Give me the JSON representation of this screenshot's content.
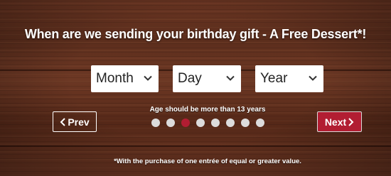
{
  "headline": "When are we sending your birthday gift - A Free Dessert*!",
  "date_selects": {
    "month": {
      "selected": "Month"
    },
    "day": {
      "selected": "Day"
    },
    "year": {
      "selected": "Year"
    }
  },
  "age_note": "Age should be more than 13 years",
  "nav": {
    "prev_label": "Prev",
    "next_label": "Next"
  },
  "progress": {
    "total_steps": 8,
    "current_step": 3
  },
  "footnote": "*With the purchase of one entrée of equal or greater value.",
  "colors": {
    "accent_red": "#b21d32",
    "wood_brown": "#5a2c1a",
    "dot_inactive": "#dcdcdc"
  },
  "icons": {
    "select_chevron": "chevron-down-icon",
    "prev": "chevron-left-icon",
    "next": "chevron-right-icon"
  }
}
